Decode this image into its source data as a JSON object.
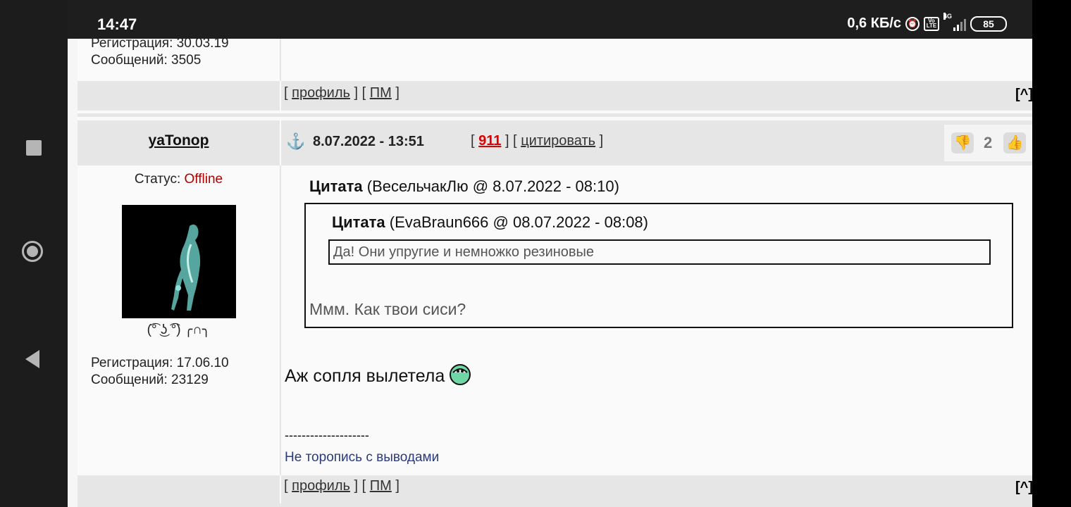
{
  "statusbar": {
    "time": "14:47",
    "net_speed": "0,6 КБ/с",
    "network_type": "4G",
    "battery": "85"
  },
  "post_prev": {
    "registration": "Регистрация: 30.03.19",
    "messages": "Сообщений: 3505",
    "links": {
      "profile": "профиль",
      "pm": "ПМ",
      "top": "[^]"
    }
  },
  "post": {
    "author": "yaTonop",
    "status_label": "Статус:",
    "status_value": "Offline",
    "date": "8.07.2022 - 13:51",
    "post_number": "911",
    "quote_link": "цитировать",
    "rating": "2",
    "avatar_caption": "(͡° ͜ʖ ͡°) ╭∩╮",
    "registration": "Регистрация: 17.06.10",
    "messages": "Сообщений: 23129",
    "quote_outer": {
      "label": "Цитата",
      "source": "(ВесельчакЛю @ 8.07.2022 - 08:10)",
      "text": "Ммм. Как твои сиси?"
    },
    "quote_inner": {
      "label": "Цитата",
      "source": "(EvaBraun666 @ 08.07.2022 - 08:08)",
      "text": "Да! Они упругие и немножко резиновые"
    },
    "body": "Аж сопля вылетела",
    "signature_divider": "--------------------",
    "signature": "Не торопись с выводами",
    "links": {
      "profile": "профиль",
      "pm": "ПМ",
      "top": "[^]"
    }
  },
  "colors": {
    "status_offline": "#b00000",
    "post_number": "#d00000",
    "signature": "#2a3a7a"
  }
}
